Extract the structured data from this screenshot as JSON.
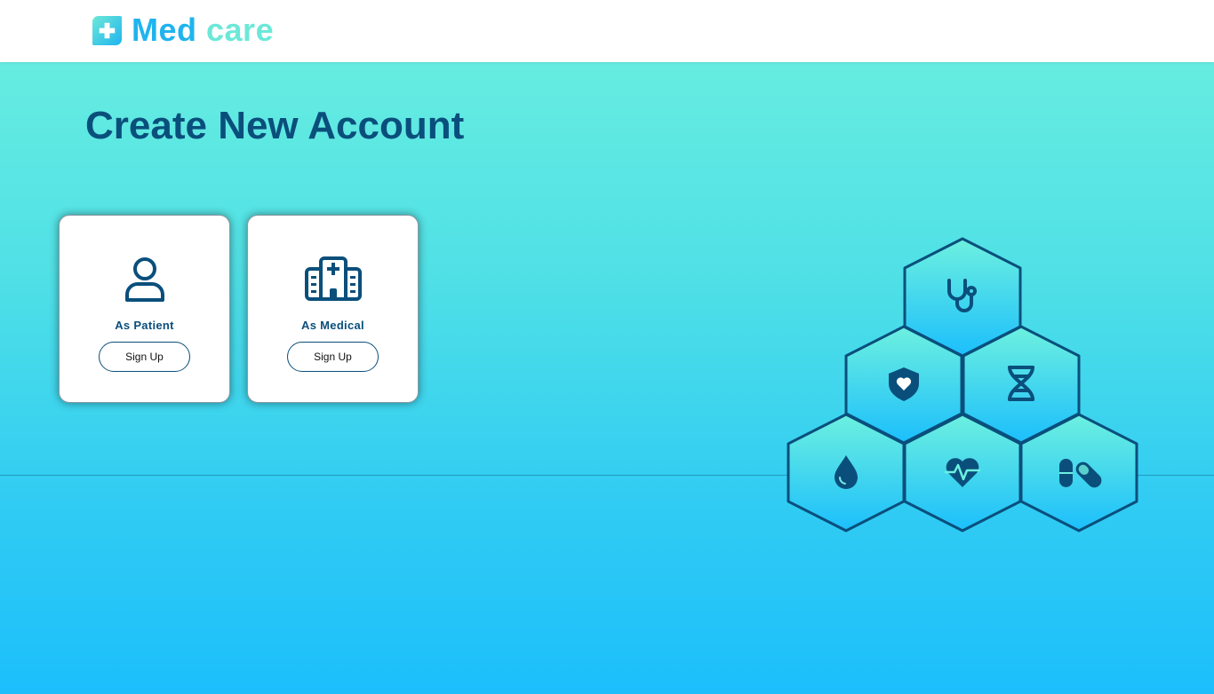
{
  "header": {
    "logo_word_1": "Med",
    "logo_word_2": "care",
    "logo_icon": "medical-cross-icon"
  },
  "main": {
    "title": "Create New Account",
    "cards": [
      {
        "label": "As Patient",
        "button": "Sign Up",
        "icon": "user-icon"
      },
      {
        "label": "As Medical",
        "button": "Sign Up",
        "icon": "hospital-icon"
      }
    ]
  },
  "decoration": {
    "hexagon_icons": [
      "stethoscope-icon",
      "shield-heart-icon",
      "dna-icon",
      "blood-drop-icon",
      "heartbeat-icon",
      "pills-icon"
    ]
  },
  "colors": {
    "brand_blue": "#1fb4ee",
    "brand_mint": "#6de8d8",
    "primary_dark": "#0a4f7c",
    "background_top": "#6df0df",
    "background_bottom": "#1cbffc"
  }
}
